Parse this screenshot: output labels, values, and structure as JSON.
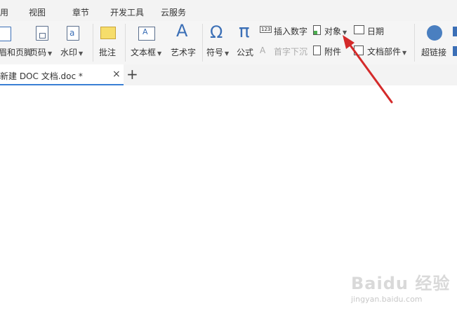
{
  "menu": {
    "items": [
      "引用",
      "视图",
      "章节",
      "开发工具",
      "云服务"
    ]
  },
  "ribbon": {
    "header_footer": "眉和页脚",
    "page_number": "页码",
    "watermark": "水印",
    "comment": "批注",
    "text_box": "文本框",
    "word_art": "艺术字",
    "symbol": "符号",
    "formula": "公式",
    "insert_number": "插入数字",
    "object": "对象",
    "date": "日期",
    "drop_cap": "首字下沉",
    "attachment": "附件",
    "doc_parts": "文档部件",
    "hyperlink": "超链接",
    "number_icon_text": "123",
    "symbol_glyph": "Ω",
    "formula_glyph": "π",
    "word_art_glyph": "A"
  },
  "tabs": {
    "doc_title": "新建 DOC 文档.doc *",
    "close_glyph": "×",
    "new_glyph": "+"
  },
  "colors": {
    "accent": "#3a7fd4",
    "arrow": "#d42a2a",
    "symbol": "#3b6fb6"
  },
  "watermark": {
    "main": "Baidu 经验",
    "sub": "jingyan.baidu.com"
  }
}
